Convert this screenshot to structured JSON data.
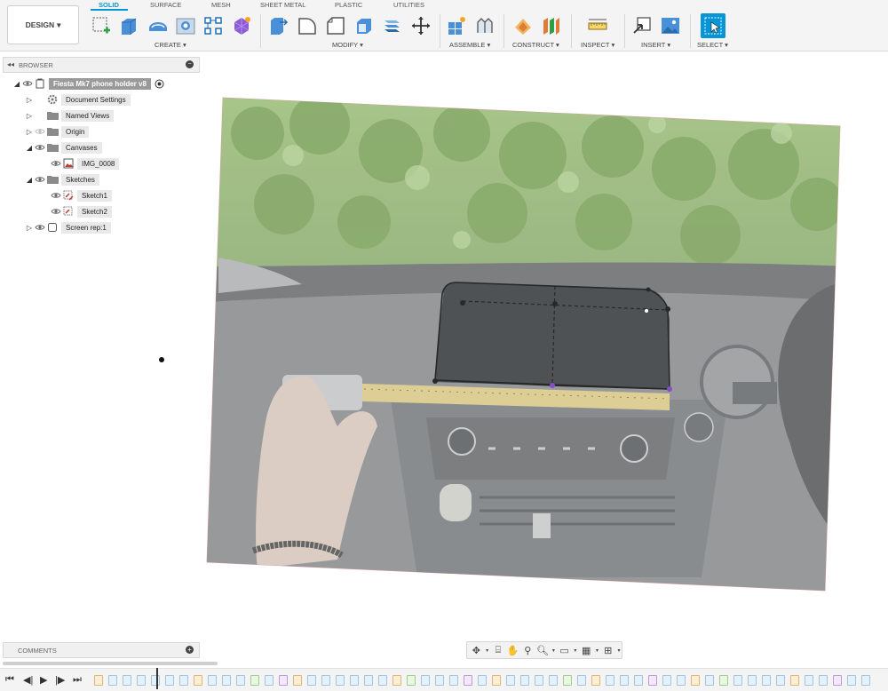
{
  "toolbar": {
    "workspace_button": "DESIGN",
    "tabs": [
      "SOLID",
      "SURFACE",
      "MESH",
      "SHEET METAL",
      "PLASTIC",
      "UTILITIES"
    ],
    "active_tab": "SOLID",
    "groups": [
      "CREATE ▾",
      "MODIFY ▾",
      "ASSEMBLE ▾",
      "CONSTRUCT ▾",
      "INSPECT ▾",
      "INSERT ▾",
      "SELECT ▾"
    ],
    "accent_color": "#0696d7"
  },
  "browser": {
    "title": "BROWSER",
    "items": [
      {
        "label": "Fiesta Mk7 phone holder v8",
        "icon": "component-icon"
      },
      {
        "label": "Document Settings",
        "icon": "gear-icon"
      },
      {
        "label": "Named Views",
        "icon": "folder-icon"
      },
      {
        "label": "Origin",
        "icon": "folder-icon"
      },
      {
        "label": "Canvases",
        "icon": "folder-icon"
      },
      {
        "label": "IMG_0008",
        "icon": "canvas-image-icon"
      },
      {
        "label": "Sketches",
        "icon": "folder-icon"
      },
      {
        "label": "Sketch1",
        "icon": "sketch-icon"
      },
      {
        "label": "Sketch2",
        "icon": "sketch-icon"
      },
      {
        "label": "Screen rep:1",
        "icon": "body-icon"
      }
    ]
  },
  "comments": {
    "title": "COMMENTS"
  },
  "navbar": {
    "icons": [
      "orbit-icon",
      "look-at-icon",
      "pan-icon",
      "zoom-window-icon",
      "zoom-icon",
      "display-settings-icon",
      "grid-icon",
      "viewports-icon"
    ]
  },
  "timeline": {
    "controls": [
      "go-to-start-icon",
      "step-back-icon",
      "play-icon",
      "step-forward-icon",
      "go-to-end-icon"
    ]
  }
}
